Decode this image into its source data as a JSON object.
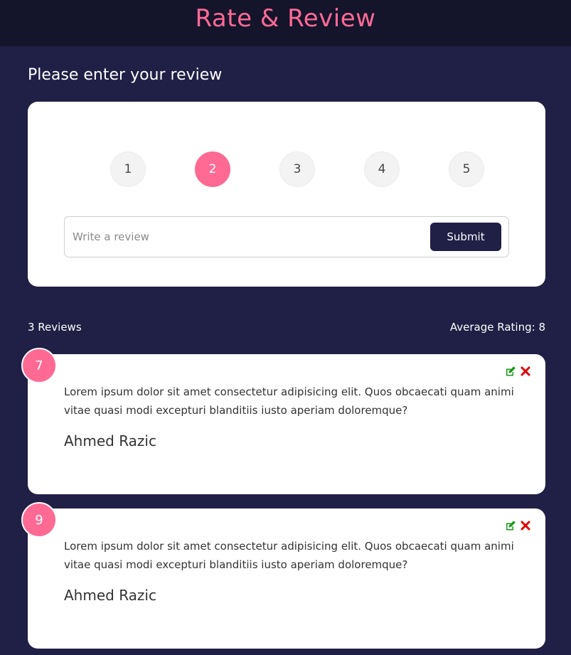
{
  "header": {
    "title": "Rate & Review"
  },
  "form": {
    "prompt": "Please enter your review",
    "ratings": [
      "1",
      "2",
      "3",
      "4",
      "5"
    ],
    "selected_rating": "2",
    "input_placeholder": "Write a review",
    "input_value": "",
    "submit_label": "Submit"
  },
  "stats": {
    "count_label": "3 Reviews",
    "average_label": "Average Rating: 8"
  },
  "reviews": [
    {
      "rating": "7",
      "text": "Lorem ipsum dolor sit amet consectetur adipisicing elit. Quos obcaecati quam animi vitae quasi modi excepturi blanditiis iusto aperiam doloremque?",
      "author": "Ahmed Razic"
    },
    {
      "rating": "9",
      "text": "Lorem ipsum dolor sit amet consectetur adipisicing elit. Quos obcaecati quam animi vitae quasi modi excepturi blanditiis iusto aperiam doloremque?",
      "author": "Ahmed Razic"
    }
  ],
  "colors": {
    "accent": "#ff6a95",
    "background": "#202046",
    "header": "#14142b",
    "edit_icon": "#1a9a1a",
    "delete_icon": "#e00000"
  },
  "icons": {
    "edit": "edit-icon",
    "delete": "delete-icon"
  }
}
